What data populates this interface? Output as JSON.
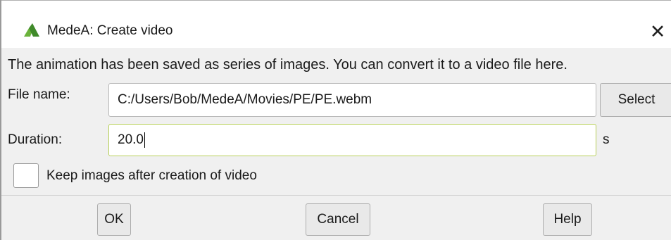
{
  "window": {
    "title": "MedeA: Create video",
    "close_glyph": "✕",
    "accent_color": "#4c9a2a"
  },
  "message": "The animation has been saved as series of images. You can convert it to a video file here.",
  "file_name": {
    "label": "File name:",
    "value": "C:/Users/Bob/MedeA/Movies/PE/PE.webm",
    "select_label": "Select"
  },
  "duration": {
    "label": "Duration:",
    "value": "20.0",
    "unit": "s"
  },
  "keep_images": {
    "label": "Keep images after creation of video",
    "checked": false
  },
  "buttons": {
    "ok": "OK",
    "cancel": "Cancel",
    "help": "Help"
  },
  "icons": {
    "app": "medea-logo-icon",
    "close": "close-icon",
    "checkbox": "checkbox-unchecked"
  }
}
